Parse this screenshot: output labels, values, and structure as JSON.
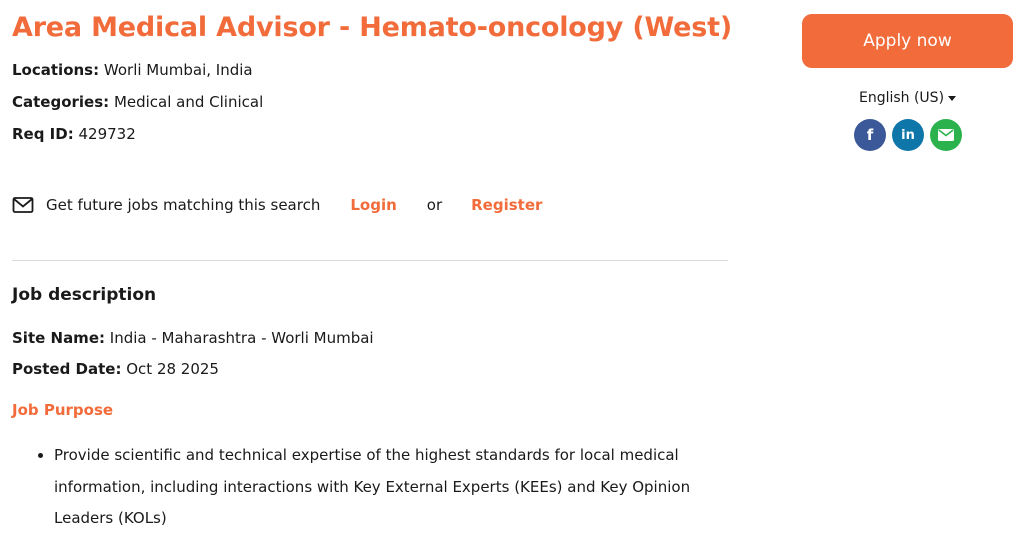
{
  "job": {
    "title": "Area Medical Advisor - Hemato-oncology (West)",
    "locations_label": "Locations:",
    "locations_value": "Worli Mumbai, India",
    "categories_label": "Categories:",
    "categories_value": "Medical and Clinical",
    "req_label": "Req ID:",
    "req_value": "429732"
  },
  "alerts": {
    "text": "Get future jobs matching this search",
    "login": "Login",
    "or": "or",
    "register": "Register"
  },
  "description": {
    "heading": "Job description",
    "site_label": "Site Name:",
    "site_value": "India - Maharashtra - Worli Mumbai",
    "posted_label": "Posted Date:",
    "posted_value": "Oct 28 2025",
    "purpose_heading": "Job Purpose",
    "bullets": [
      "Provide scientific and technical expertise of the highest standards for local medical information, including interactions with Key External Experts (KEEs) and Key Opinion Leaders (KOLs)"
    ]
  },
  "sidebar": {
    "apply_label": "Apply now",
    "language": "English (US)",
    "social": {
      "facebook": "f",
      "linkedin": "in"
    }
  },
  "colors": {
    "accent": "#f26b3a",
    "facebook": "#3b5998",
    "linkedin": "#0e76a8",
    "email": "#2bb24c"
  }
}
